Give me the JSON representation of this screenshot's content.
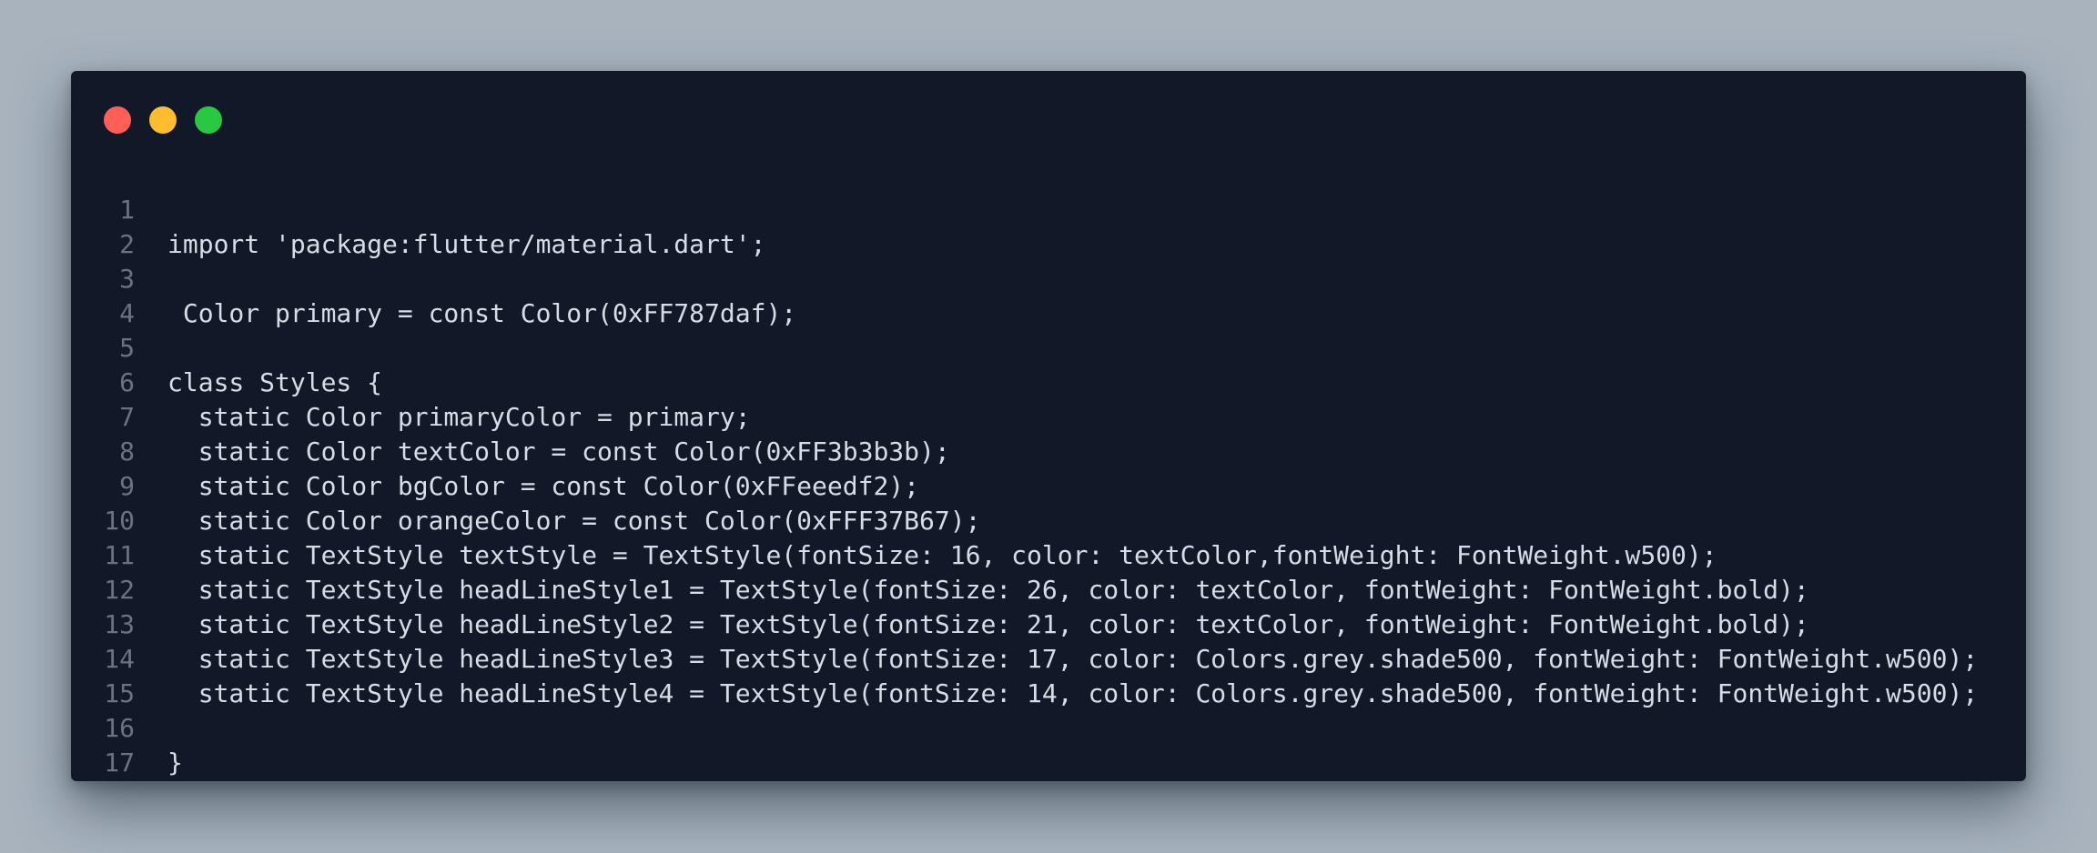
{
  "window": {
    "controls": {
      "close_color": "#ff5f57",
      "minimize_color": "#febc2e",
      "maximize_color": "#28c840"
    }
  },
  "code": {
    "lines": [
      {
        "n": "1",
        "text": "import 'package:flutter/material.dart';"
      },
      {
        "n": "2",
        "text": ""
      },
      {
        "n": "3",
        "text": " Color primary = const Color(0xFF787daf);"
      },
      {
        "n": "4",
        "text": ""
      },
      {
        "n": "5",
        "text": "class Styles {"
      },
      {
        "n": "6",
        "text": "  static Color primaryColor = primary;"
      },
      {
        "n": "7",
        "text": "  static Color textColor = const Color(0xFF3b3b3b);"
      },
      {
        "n": "8",
        "text": "  static Color bgColor = const Color(0xFFeeedf2);"
      },
      {
        "n": "9",
        "text": "  static Color orangeColor = const Color(0xFFF37B67);"
      },
      {
        "n": "10",
        "text": "  static TextStyle textStyle = TextStyle(fontSize: 16, color: textColor,fontWeight: FontWeight.w500);"
      },
      {
        "n": "11",
        "text": "  static TextStyle headLineStyle1 = TextStyle(fontSize: 26, color: textColor, fontWeight: FontWeight.bold);"
      },
      {
        "n": "12",
        "text": "  static TextStyle headLineStyle2 = TextStyle(fontSize: 21, color: textColor, fontWeight: FontWeight.bold);"
      },
      {
        "n": "13",
        "text": "  static TextStyle headLineStyle3 = TextStyle(fontSize: 17, color: Colors.grey.shade500, fontWeight: FontWeight.w500);"
      },
      {
        "n": "14",
        "text": "  static TextStyle headLineStyle4 = TextStyle(fontSize: 14, color: Colors.grey.shade500, fontWeight: FontWeight.w500);"
      },
      {
        "n": "15",
        "text": ""
      },
      {
        "n": "16",
        "text": "}"
      },
      {
        "n": "17",
        "text": ""
      }
    ]
  }
}
